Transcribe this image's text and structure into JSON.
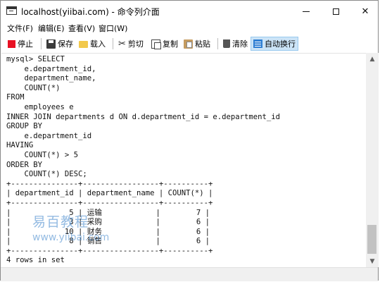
{
  "window": {
    "title": "localhost(yiibai.com) - 命令列介面",
    "controls": {
      "minimize": "—",
      "maximize": "□",
      "close": "✕"
    }
  },
  "menu": {
    "items": [
      "文件(F)",
      "编辑(E)",
      "查看(V)",
      "窗口(W)"
    ]
  },
  "toolbar": {
    "stop": "停止",
    "save": "保存",
    "load": "载入",
    "cut": "剪切",
    "copy": "复制",
    "paste": "粘贴",
    "clear": "清除",
    "autowrap": "自动换行"
  },
  "console": {
    "output": "mysql> SELECT\n    e.department_id,\n    department_name,\n    COUNT(*)\nFROM\n    employees e\nINNER JOIN departments d ON d.department_id = e.department_id\nGROUP BY\n    e.department_id\nHAVING\n    COUNT(*) > 5\nORDER BY\n    COUNT(*) DESC;\n+---------------+-----------------+----------+\n| department_id | department_name | COUNT(*) |\n+---------------+-----------------+----------+\n|             5 | 运输            |        7 |\n|             3 | 采购            |        6 |\n|            10 | 财务            |        6 |\n|             8 | 销售            |        6 |\n+---------------+-----------------+----------+\n4 rows in set"
  },
  "watermark": {
    "brand": "易百教程",
    "url": "www.yiibai.com"
  },
  "icons": {
    "app": "console-window-icon",
    "stop": "stop-square-icon",
    "save": "floppy-disk-icon",
    "load": "folder-icon",
    "cut": "scissors-icon",
    "copy": "copy-icon",
    "paste": "clipboard-icon",
    "clear": "trash-icon",
    "autowrap": "word-wrap-icon"
  },
  "colors": {
    "stop_red": "#e81123",
    "autowrap_highlight": "#cce4f7",
    "watermark_blue": "#5a96d2"
  }
}
